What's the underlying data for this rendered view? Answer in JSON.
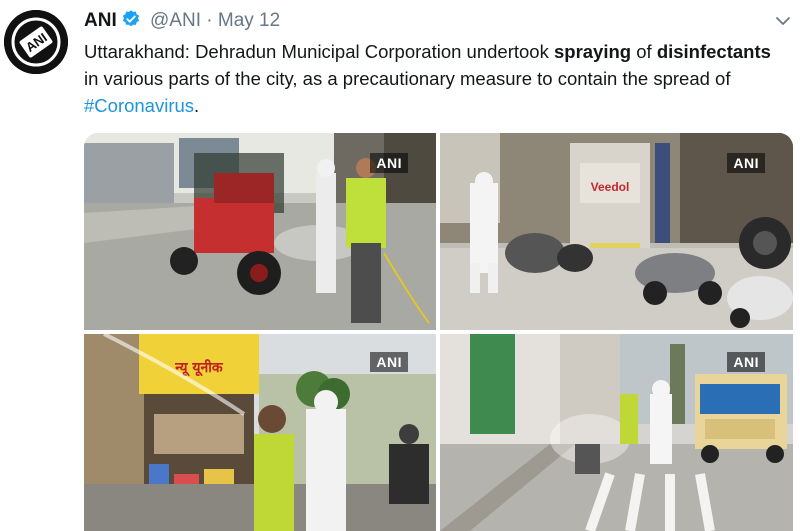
{
  "tweet": {
    "author_name": "ANI",
    "handle": "@ANI",
    "separator": "·",
    "date": "May 12",
    "avatar_logo_text": "ANI",
    "text_parts": [
      "Uttarakhand: Dehradun Municipal Corporation undertook ",
      "spraying",
      " of ",
      "disinfectants",
      " in various parts of the city, as a precautionary measure to contain the spread of ",
      "#Coronavirus",
      "."
    ]
  },
  "photos": [
    {
      "watermark": "ANI",
      "description_icon": "photo-tractor-spraying"
    },
    {
      "watermark": "ANI",
      "description_icon": "photo-street-spraying",
      "sign_text": "Veedol"
    },
    {
      "watermark": "ANI",
      "description_icon": "photo-shop-spraying",
      "sign_text": "न्यू यूनीक"
    },
    {
      "watermark": "ANI",
      "description_icon": "photo-road-spraying"
    }
  ],
  "colors": {
    "link": "#1b95e0",
    "verified": "#1da1f2",
    "muted": "#657786",
    "text": "#14171a"
  }
}
